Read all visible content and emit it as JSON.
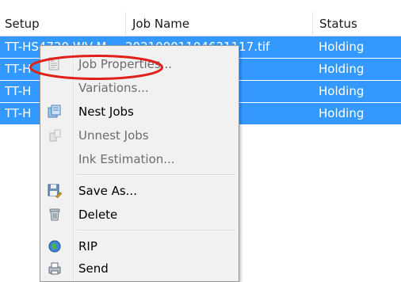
{
  "table": {
    "columns": [
      "Setup",
      "Job Name",
      "Status"
    ],
    "rows": [
      {
        "setup": "TT-HS4720-WV-M",
        "job_name": "20210901104631117.tif",
        "status": "Holding"
      },
      {
        "setup": "TT-H",
        "job_name": "",
        "status": "Holding"
      },
      {
        "setup": "TT-H",
        "job_name": "",
        "status": "Holding"
      },
      {
        "setup": "TT-H",
        "job_name": "",
        "status": "Holding"
      }
    ]
  },
  "context_menu": {
    "items": [
      {
        "label": "Job Properties...",
        "icon": "job-properties-icon",
        "enabled": false
      },
      {
        "label": "Variations...",
        "icon": "",
        "enabled": false
      },
      {
        "label": "Nest Jobs",
        "icon": "nest-jobs-icon",
        "enabled": true
      },
      {
        "label": "Unnest Jobs",
        "icon": "unnest-jobs-icon",
        "enabled": false
      },
      {
        "label": "Ink Estimation...",
        "icon": "",
        "enabled": false
      },
      {
        "label": "Save As...",
        "icon": "save-as-icon",
        "enabled": true
      },
      {
        "label": "Delete",
        "icon": "delete-icon",
        "enabled": true
      },
      {
        "label": "RIP",
        "icon": "rip-icon",
        "enabled": true
      },
      {
        "label": "Send",
        "icon": "send-icon",
        "enabled": true
      }
    ]
  },
  "colors": {
    "selection": "#3399ff",
    "highlight_ring": "#e0201a",
    "menu_background": "#f1f1f1"
  }
}
